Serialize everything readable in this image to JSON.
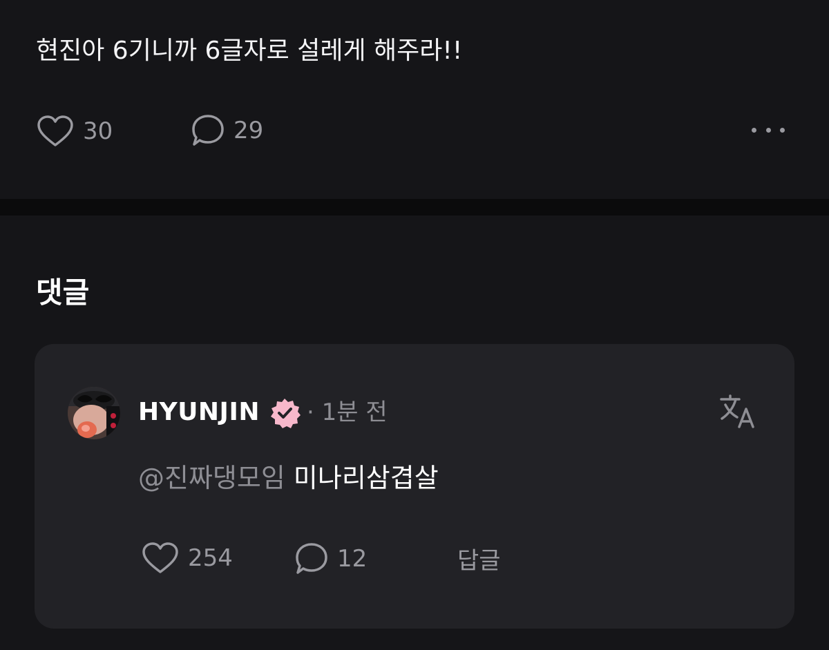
{
  "post": {
    "text": "현진아 6기니까 6글자로 설레게 해주라!!",
    "likes": "30",
    "comments": "29"
  },
  "comments_section": {
    "title": "댓글"
  },
  "comment": {
    "username": "HYUNJIN",
    "time": "· 1분 전",
    "mention": "@진짜댕모임",
    "text": "미나리삼겹살",
    "likes": "254",
    "replies": "12",
    "reply_label": "답글"
  },
  "colors": {
    "background": "#151518",
    "card": "#222226",
    "muted": "#9a9aa0",
    "verified_badge": "#f7b8cb"
  },
  "icons": [
    "heart-icon",
    "comment-bubble-icon",
    "more-icon",
    "verified-badge-icon",
    "translate-icon"
  ]
}
